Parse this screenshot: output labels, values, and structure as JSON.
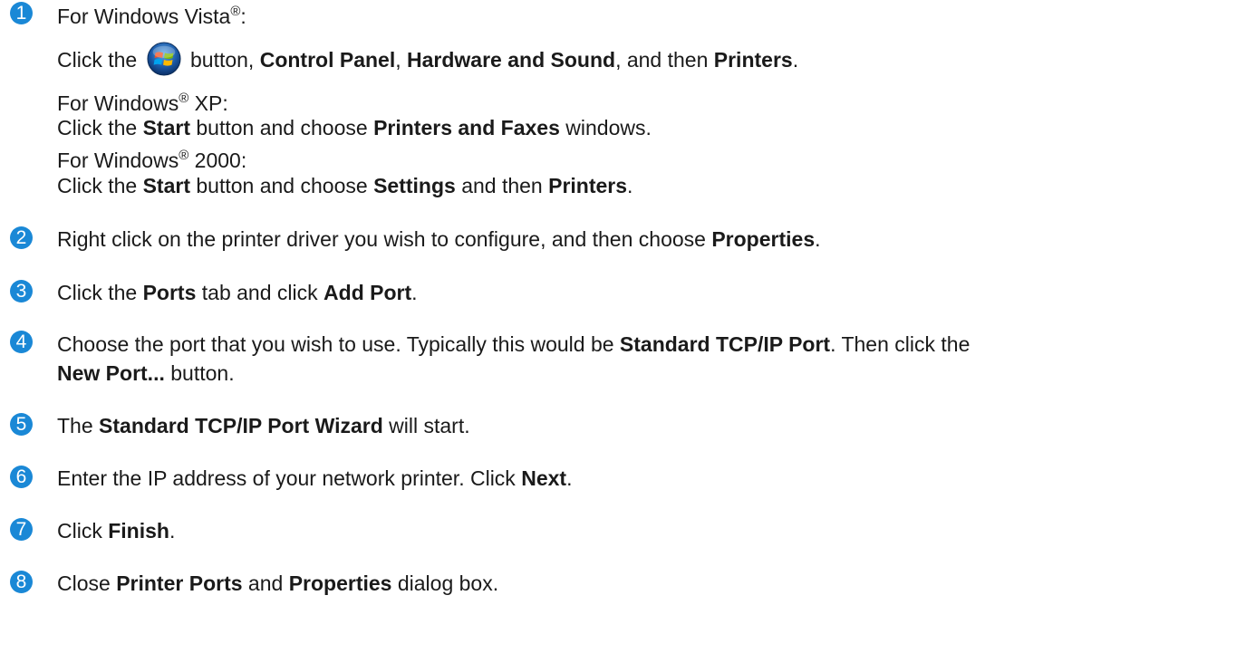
{
  "colors": {
    "step_number": "#1a88d6",
    "text": "#1a1a1a"
  },
  "step1": {
    "number": "1",
    "vista_heading_pre": "For Windows Vista",
    "vista_heading_post": ":",
    "vista_click": "Click the",
    "vista_button": "button,",
    "vista_control_panel": "Control Panel",
    "vista_sep1": ",",
    "vista_hardware": "Hardware and Sound",
    "vista_and_then": ", and then",
    "vista_printers": "Printers",
    "vista_end": ".",
    "start_icon": "windows-start-orb-icon",
    "xp_heading_pre": "For Windows",
    "xp_heading_post": " XP:",
    "xp_click": "Click the",
    "xp_start": "Start",
    "xp_choose": "button and choose",
    "xp_printers_faxes": "Printers and Faxes",
    "xp_windows": "windows.",
    "w2k_heading_pre": "For Windows",
    "w2k_heading_post": " 2000:",
    "w2k_click": "Click the",
    "w2k_start": "Start",
    "w2k_choose": "button and choose",
    "w2k_settings": "Settings",
    "w2k_and_then": "and then",
    "w2k_printers": "Printers",
    "w2k_end": ".",
    "registered": "®"
  },
  "step2": {
    "number": "2",
    "text": "Right click on the printer driver you wish to configure, and then choose",
    "bold": "Properties",
    "end": "."
  },
  "step3": {
    "number": "3",
    "pre": "Click the",
    "ports": "Ports",
    "mid": "tab and click",
    "add_port": "Add Port",
    "end": "."
  },
  "step4": {
    "number": "4",
    "pre": "Choose the port that you wish to use. Typically this would be",
    "std_port": "Standard TCP/IP Port",
    "mid": ". Then click the",
    "new_port": "New Port...",
    "end": "button."
  },
  "step5": {
    "number": "5",
    "pre": "The",
    "wizard": "Standard TCP/IP Port Wizard",
    "end": "will start."
  },
  "step6": {
    "number": "6",
    "pre": "Enter the IP address of your network printer. Click",
    "next": "Next",
    "end": "."
  },
  "step7": {
    "number": "7",
    "pre": "Click",
    "finish": "Finish",
    "end": "."
  },
  "step8": {
    "number": "8",
    "pre": "Close",
    "printer_ports": "Printer Ports",
    "mid": "and",
    "properties": "Properties",
    "end": "dialog box."
  }
}
